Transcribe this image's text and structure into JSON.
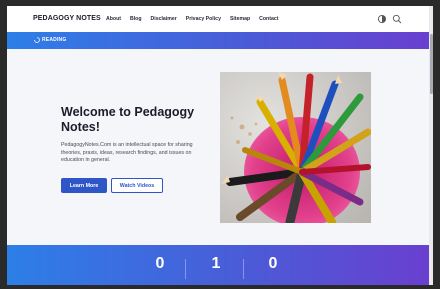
{
  "header": {
    "brand": "PEDAGOGY NOTES",
    "nav": [
      "About",
      "Blog",
      "Disclaimer",
      "Privacy Policy",
      "Sitemap",
      "Contact"
    ],
    "icons": [
      "theme-toggle-icon",
      "search-icon"
    ]
  },
  "ribbon": {
    "label": "READING",
    "icon": "spinner-icon"
  },
  "hero": {
    "title": "Welcome to Pedagogy Notes!",
    "description": "PedagogyNotes.Com is an intellectual space for sharing theories, praxis, ideas, research findings, and issues on education in general.",
    "primary_button": "Learn More",
    "secondary_button": "Watch Videos",
    "image": "colored-pencils-in-pink-cup"
  },
  "counters": [
    "0",
    "1",
    "0"
  ],
  "colors": {
    "accent_start": "#2d7fe8",
    "accent_end": "#6a3fcf",
    "primary_button": "#2e56c7",
    "title_text": "#1c1c2a"
  }
}
